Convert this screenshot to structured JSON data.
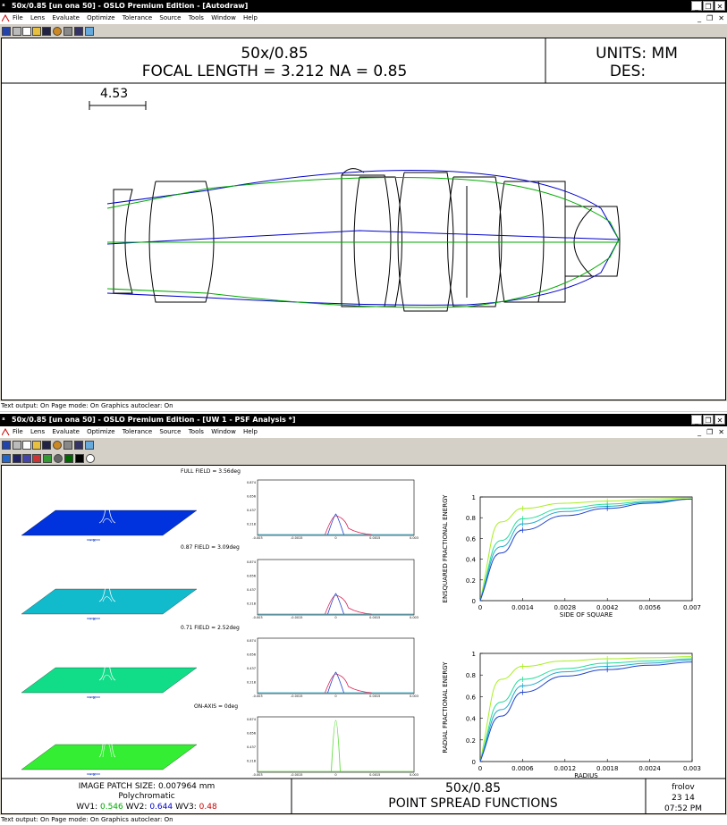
{
  "window_top": {
    "title": "50x/0.85 [un ona 50] - OSLO Premium Edition - [Autodraw]",
    "menu": [
      "File",
      "Lens",
      "Evaluate",
      "Optimize",
      "Tolerance",
      "Source",
      "Tools",
      "Window",
      "Help"
    ],
    "title_block": {
      "line1": "50x/0.85",
      "line2": "FOCAL LENGTH = 3.212   NA = 0.85",
      "units": "UNITS: MM",
      "des": "DES:"
    },
    "scale_label": "4.53",
    "status": "Text output: On  Page mode: On   Graphics autoclear: On",
    "ray_colors": {
      "ray1": "#0000cc",
      "ray2": "#00aa00"
    }
  },
  "window_bottom": {
    "title": "50x/0.85 [un ona 50] - OSLO Premium Edition - [UW 1 - PSF Analysis *]",
    "menu": [
      "File",
      "Lens",
      "Evaluate",
      "Optimize",
      "Tolerance",
      "Source",
      "Tools",
      "Window",
      "Help"
    ],
    "fields": [
      {
        "label": "FULL FIELD = 3.56deg",
        "surface_color": "#0033dd"
      },
      {
        "label": "0.87 FIELD = 3.09deg",
        "surface_color": "#11bbcc"
      },
      {
        "label": "0.71 FIELD = 2.52deg",
        "surface_color": "#11dd88"
      },
      {
        "label": "ON-AXIS = 0deg",
        "surface_color": "#33ee33"
      }
    ],
    "small_axis_label": "→ x",
    "psf_yticks": [
      "0.874",
      "0.656",
      "0.437",
      "0.218"
    ],
    "psf_xticks": [
      "-0.003",
      "-0.0015",
      "0",
      "0.0015",
      "0.003"
    ],
    "ensquared": {
      "ylabel": "ENSQUARED FRACTIONAL ENERGY",
      "xlabel": "SIDE OF SQUARE",
      "xticks": [
        "0",
        "0.0014",
        "0.0028",
        "0.0042",
        "0.0056",
        "0.007"
      ],
      "yticks": [
        "0",
        "0.2",
        "0.4",
        "0.6",
        "0.8",
        "1"
      ]
    },
    "radial": {
      "ylabel": "RADIAL FRACTIONAL ENERGY",
      "xlabel": "RADIUS",
      "xticks": [
        "0",
        "0.0006",
        "0.0012",
        "0.0018",
        "0.0024",
        "0.003"
      ],
      "yticks": [
        "0",
        "0.2",
        "0.4",
        "0.6",
        "0.8",
        "1"
      ]
    },
    "footer": {
      "patch": "IMAGE PATCH SIZE: 0.007964 mm",
      "poly": "Polychromatic",
      "wv_prefix": "WV1:",
      "wv1": "0.546",
      "wv2_prefix": "WV2:",
      "wv2": "0.644",
      "wv3_prefix": "WV3:",
      "wv3": "0.48",
      "title1": "50x/0.85",
      "title2": "POINT SPREAD FUNCTIONS",
      "user": "frolov",
      "date": "23 14",
      "time": "07:52 PM"
    },
    "status": "Text output: On  Page mode: On   Graphics autoclear: On"
  },
  "chart_data": [
    {
      "type": "line",
      "title": "",
      "xlabel": "SIDE OF SQUARE",
      "ylabel": "ENSQUARED FRACTIONAL ENERGY",
      "xlim": [
        0,
        0.007
      ],
      "ylim": [
        0,
        1
      ],
      "x": [
        0,
        0.0007,
        0.0014,
        0.0028,
        0.0042,
        0.0056,
        0.007
      ],
      "series": [
        {
          "color": "#aaee22",
          "values": [
            0,
            0.76,
            0.89,
            0.94,
            0.96,
            0.98,
            0.99
          ]
        },
        {
          "color": "#22dd99",
          "values": [
            0,
            0.58,
            0.79,
            0.89,
            0.93,
            0.96,
            0.98
          ]
        },
        {
          "color": "#22aacc",
          "values": [
            0,
            0.52,
            0.74,
            0.86,
            0.91,
            0.95,
            0.98
          ]
        },
        {
          "color": "#2244cc",
          "values": [
            0,
            0.46,
            0.68,
            0.82,
            0.89,
            0.94,
            0.98
          ]
        }
      ]
    },
    {
      "type": "line",
      "title": "",
      "xlabel": "RADIUS",
      "ylabel": "RADIAL FRACTIONAL ENERGY",
      "xlim": [
        0,
        0.003
      ],
      "ylim": [
        0,
        1
      ],
      "x": [
        0,
        0.0003,
        0.0006,
        0.0012,
        0.0018,
        0.0024,
        0.003
      ],
      "series": [
        {
          "color": "#aaee22",
          "values": [
            0,
            0.76,
            0.88,
            0.93,
            0.95,
            0.96,
            0.97
          ]
        },
        {
          "color": "#22dd99",
          "values": [
            0,
            0.55,
            0.76,
            0.86,
            0.91,
            0.93,
            0.95
          ]
        },
        {
          "color": "#22aacc",
          "values": [
            0,
            0.48,
            0.7,
            0.83,
            0.88,
            0.91,
            0.94
          ]
        },
        {
          "color": "#2244cc",
          "values": [
            0,
            0.42,
            0.64,
            0.79,
            0.85,
            0.89,
            0.92
          ]
        }
      ]
    }
  ]
}
